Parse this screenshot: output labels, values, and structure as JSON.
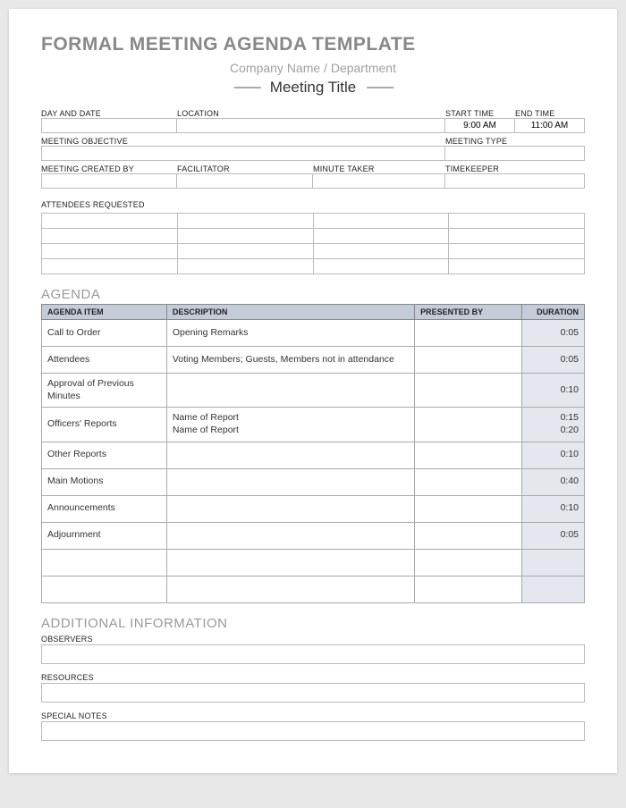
{
  "header": {
    "main_title": "FORMAL MEETING AGENDA TEMPLATE",
    "company": "Company Name / Department",
    "meeting_title": "Meeting Title"
  },
  "labels": {
    "day_date": "DAY AND DATE",
    "location": "LOCATION",
    "start_time": "START TIME",
    "end_time": "END TIME",
    "objective": "MEETING OBJECTIVE",
    "type": "MEETING TYPE",
    "created_by": "MEETING CREATED BY",
    "facilitator": "FACILITATOR",
    "minute_taker": "MINUTE TAKER",
    "timekeeper": "TIMEKEEPER",
    "attendees": "ATTENDEES REQUESTED",
    "agenda": "AGENDA",
    "additional": "ADDITIONAL INFORMATION",
    "observers": "OBSERVERS",
    "resources": "RESOURCES",
    "special_notes": "SPECIAL NOTES"
  },
  "values": {
    "day_date": "",
    "location": "",
    "start_time": "9:00 AM",
    "end_time": "11:00 AM",
    "objective": "",
    "type": "",
    "created_by": "",
    "facilitator": "",
    "minute_taker": "",
    "timekeeper": ""
  },
  "agenda_headers": {
    "item": "AGENDA ITEM",
    "description": "DESCRIPTION",
    "presented_by": "PRESENTED BY",
    "duration": "DURATION"
  },
  "agenda_items": [
    {
      "item": "Call to Order",
      "description": "Opening Remarks",
      "presented_by": "",
      "duration": "0:05"
    },
    {
      "item": "Attendees",
      "description": "Voting Members; Guests, Members not in attendance",
      "presented_by": "",
      "duration": "0:05"
    },
    {
      "item": "Approval of Previous Minutes",
      "description": "",
      "presented_by": "",
      "duration": "0:10"
    },
    {
      "item": "Officers' Reports",
      "description": "Name of Report\nName of Report",
      "presented_by": "",
      "duration": "0:15\n0:20"
    },
    {
      "item": "Other Reports",
      "description": "",
      "presented_by": "",
      "duration": "0:10"
    },
    {
      "item": "Main Motions",
      "description": "",
      "presented_by": "",
      "duration": "0:40"
    },
    {
      "item": "Announcements",
      "description": "",
      "presented_by": "",
      "duration": "0:10"
    },
    {
      "item": "Adjournment",
      "description": "",
      "presented_by": "",
      "duration": "0:05"
    },
    {
      "item": "",
      "description": "",
      "presented_by": "",
      "duration": ""
    },
    {
      "item": "",
      "description": "",
      "presented_by": "",
      "duration": ""
    }
  ]
}
